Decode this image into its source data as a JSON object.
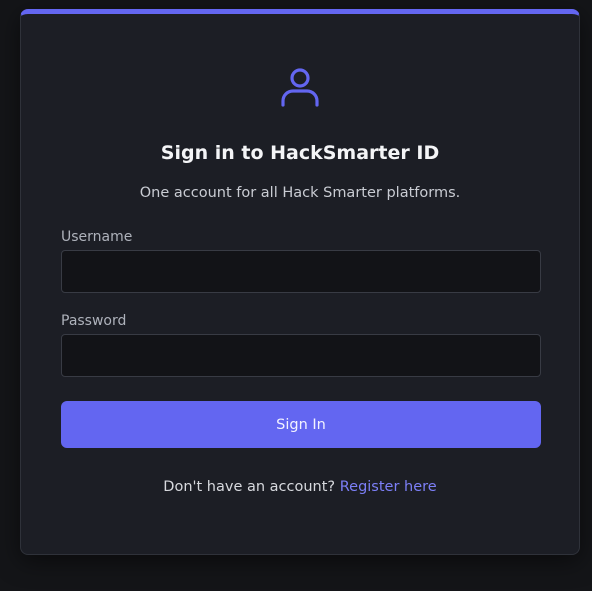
{
  "login": {
    "icon": "user-icon",
    "title": "Sign in to HackSmarter ID",
    "subtitle": "One account for all Hack Smarter platforms.",
    "username_label": "Username",
    "username_value": "",
    "password_label": "Password",
    "password_value": "",
    "submit_label": "Sign In",
    "footer_text": "Don't have an account?",
    "register_link": "Register here"
  },
  "colors": {
    "accent": "#6366f1",
    "link": "#7c7ff7",
    "card_bg": "#1c1e25",
    "page_bg": "#141518",
    "input_bg": "#121317"
  }
}
